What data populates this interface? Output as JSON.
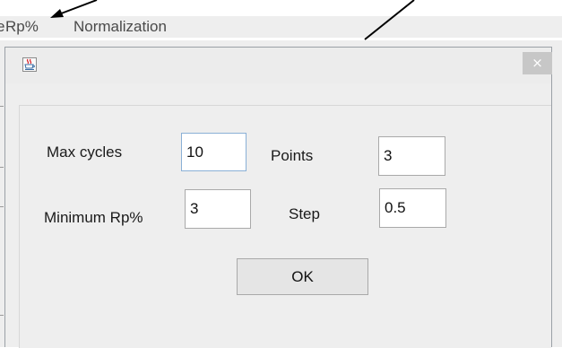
{
  "menubar": {
    "partial_item": "e",
    "items": [
      "Rp%",
      "Normalization"
    ]
  },
  "dialog": {
    "icon": "java-coffee-cup-icon",
    "close_label": "×",
    "fields": {
      "max_cycles": {
        "label": "Max cycles",
        "value": "10"
      },
      "points": {
        "label": "Points",
        "value": "3"
      },
      "minimum_rp": {
        "label": "Minimum Rp%",
        "value": "3"
      },
      "step": {
        "label": "Step",
        "value": "0.5"
      }
    },
    "ok_label": "OK"
  },
  "colors": {
    "panel_background": "#eeeeee",
    "close_button_background": "#c7c7c7",
    "field_background": "#ffffff",
    "annotation_arrow": "#000000"
  }
}
